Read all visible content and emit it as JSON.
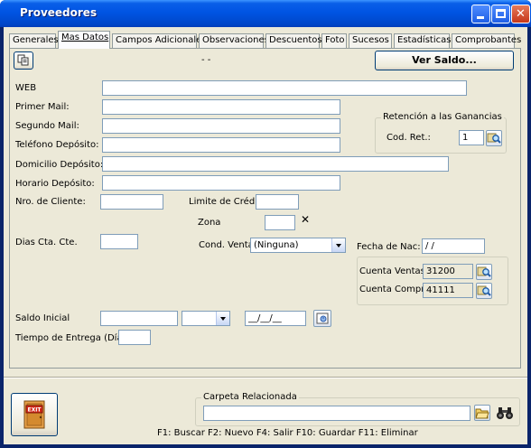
{
  "window": {
    "title": "Proveedores",
    "colors": {
      "titlebar": "#0054e3",
      "face": "#ece9d8",
      "close": "#c6381a"
    }
  },
  "title_buttons": {
    "minimize_icon": "minimize-icon",
    "maximize_icon": "maximize-icon",
    "close_glyph": "✕"
  },
  "tabs": [
    {
      "label": "Generales"
    },
    {
      "label": "Mas Datos"
    },
    {
      "label": "Campos Adicionales"
    },
    {
      "label": "Observaciones"
    },
    {
      "label": "Descuentos"
    },
    {
      "label": "Foto"
    },
    {
      "label": "Sucesos"
    },
    {
      "label": "Estadísticas"
    },
    {
      "label": "Comprobantes"
    }
  ],
  "toolbar": {
    "dash_text": "- -",
    "ver_saldo_label": "Ver Saldo..."
  },
  "form": {
    "web_label": "WEB",
    "primer_mail_label": "Primer Mail:",
    "segundo_mail_label": "Segundo Mail:",
    "telefono_label": "Teléfono Depósito:",
    "domicilio_label": "Domicilio Depósito:",
    "horario_label": "Horario Depósito:",
    "nro_cliente_label": "Nro. de Cliente:",
    "limite_credito_label": "Limite de Crédito",
    "zona_label": "Zona",
    "zona_clear": "✕",
    "dias_cta_label": "Dias Cta. Cte.",
    "cond_venta_label": "Cond. Venta",
    "cond_venta_value": "(Ninguna)",
    "fecha_nac_label": "Fecha de Nac:",
    "fecha_nac_value": " /  /",
    "saldo_inicial_label": "Saldo Inicial",
    "saldo_date_value": "__/__/__",
    "tiempo_entrega_label": "Tiempo de Entrega (Días):"
  },
  "retencion": {
    "title": "Retención a las Ganancias",
    "cod_label": "Cod. Ret.:",
    "cod_value": "1"
  },
  "cuentas": {
    "ventas_label": "Cuenta Ventas",
    "ventas_value": "31200",
    "compras_label": "Cuenta Compras",
    "compras_value": "41111"
  },
  "bottom": {
    "exit_label": "EXIT",
    "carpeta_title": "Carpeta Relacionada",
    "status_text": "F1: Buscar  F2: Nuevo  F4: Salir  F10: Guardar  F11: Eliminar"
  }
}
